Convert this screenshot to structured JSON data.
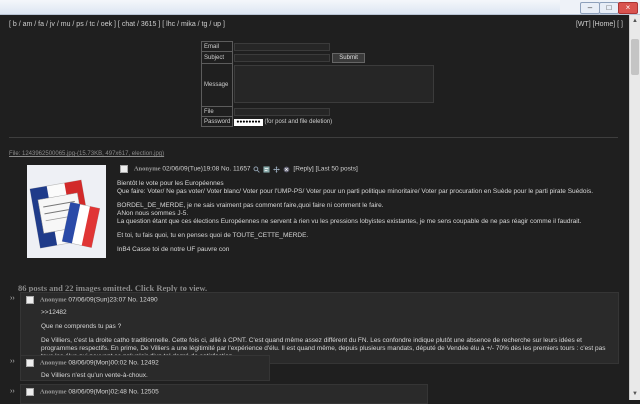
{
  "nav": {
    "left": "[ b / am / fa / jv / mu / ps / tc / oek ] [ chat / 3615 ] [ lhc / mika / tg / up ]",
    "right": "[WT] [Home] [ ]"
  },
  "form": {
    "email_label": "Email",
    "subject_label": "Subject",
    "message_label": "Message",
    "file_label": "File",
    "password_label": "Password",
    "password_value": "●●●●●●●●",
    "password_hint": "(for post and file deletion)",
    "submit_label": "Submit"
  },
  "op": {
    "file_info": "File: 1243962500065.jpg-(15.73KB, 497x617, election.jpg)",
    "name": "Anonyme",
    "date": "02/06/09(Tue)19:08",
    "number": "No. 11657",
    "reply_link": "[Reply]",
    "last50_link": "[Last 50 posts]",
    "paragraphs": [
      "Bientôt le vote pour les Européennes\nQue faire: Voter/ Ne pas voter/ Voter blanc/ Voter pour l'UMP-PS/ Voter pour un parti politique minoritaire/ Voter par procuration en Suède pour le parti pirate Suédois.",
      "BORDEL_DE_MERDE, je ne sais vraiment pas comment faire,quoi faire ni comment le faire.\nANon nous sommes J-5.\nLa question étant que ces élections Européennes ne servent à rien vu les pressions lobyistes existantes, je me sens coupable de ne pas réagir comme il faudrait.",
      "Et toi, tu fais quoi, tu en penses quoi de TOUTE_CETTE_MERDE.",
      "InB4 Casse toi de notre UF pauvre con"
    ]
  },
  "omitted": "86 posts and 22 images omitted. Click Reply to view.",
  "replies": [
    {
      "name": "Anonyme",
      "date": "07/06/09(Sun)23:07",
      "number": "No. 12490",
      "paragraphs": [
        ">>12482",
        "Que ne comprends tu pas ?",
        "De Villiers, c'est la droite catho traditionnelle. Cette fois ci, allié à CPNT. C'est quand même assez différent du FN. Les confondre indique plutôt une absence de recherche sur leurs idées et programmes respectifs. En prime, De Villiers a une légitimité par l'expérience d'élu. Il est quand même, depuis plusieurs mandats, député de Vendée élu à +/- 70% dès les premiers tours : c'est pas tous les élus qui peuvent se prévaloir d'un tel degré de satisfaction."
      ]
    },
    {
      "name": "Anonyme",
      "date": "08/06/09(Mon)00:02",
      "number": "No. 12492",
      "paragraphs": [
        "De Villiers n'est qu'un vente-à-choux."
      ]
    },
    {
      "name": "Anonyme",
      "date": "08/06/09(Mon)02:48",
      "number": "No. 12505",
      "paragraphs": []
    }
  ],
  "icons": [
    "checkbox-icon",
    "search-icon",
    "quote-icon",
    "move-icon",
    "close-icon"
  ],
  "colors": {
    "background": "#1f1f1f",
    "reply_bg": "#2a2a2a",
    "name": "#9c9c9c"
  }
}
